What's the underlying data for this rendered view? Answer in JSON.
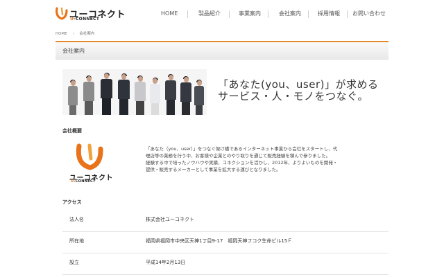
{
  "header": {
    "logo_jp": "ユーコネクト",
    "logo_en": "U-CONNECT",
    "nav": [
      "HOME",
      "製品紹介",
      "事業案内",
      "会社案内",
      "採用情報",
      "お問い合わせ"
    ]
  },
  "breadcrumb": [
    "HOME",
    "›",
    "会社案内"
  ],
  "page_title": "会社案内",
  "hero": {
    "tagline_line1": "「あなた(you、user)」が求める",
    "tagline_line2": "サービス・人・モノをつなぐ。"
  },
  "about": {
    "label": "会社概要",
    "logo_jp": "ユーコネクト",
    "logo_en": "U-CONNECT",
    "text_lines": [
      "「あなた（you、user）」をつなぐ架け橋であるインターネット事業から会社をスタートし、代",
      "理店等の業務を行う中、お客様や企業とのやり取りを通じて販売経験を積んで参りました。",
      "経験する中で培ったノウハウや実績、コネクションを活かし、2012年、よりよいものを開発・",
      "提供・販売するメーカーとして事業を拡大する運びとなりました。"
    ]
  },
  "access": {
    "label": "アクセス",
    "rows": [
      {
        "key": "法人名",
        "value": "株式会社ユーコネクト"
      },
      {
        "key": "所在地",
        "value": "福岡県福岡市中央区天神1丁目9-17　福岡天神フコク生命ビル15Ｆ"
      },
      {
        "key": "設立",
        "value": "平成14年2月13日"
      }
    ]
  },
  "colors": {
    "accent": "#e58a2c",
    "brand_orange": "#e8731a"
  }
}
